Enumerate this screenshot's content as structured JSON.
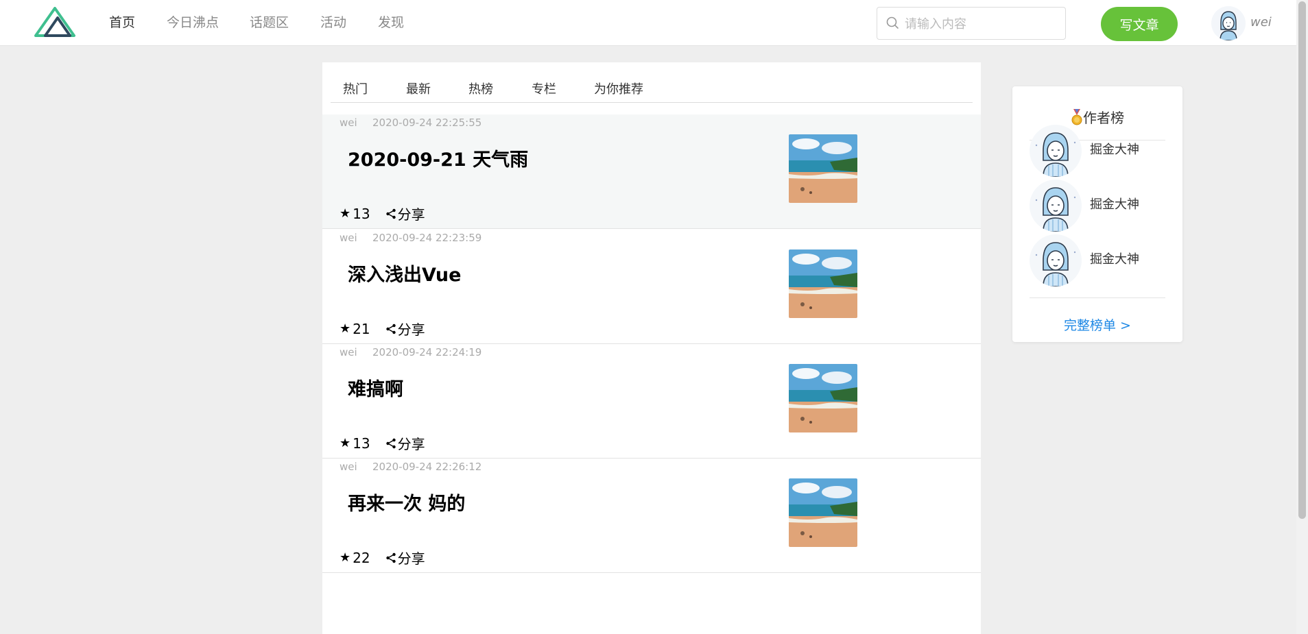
{
  "header": {
    "nav": [
      {
        "label": "首页",
        "active": true
      },
      {
        "label": "今日沸点",
        "active": false
      },
      {
        "label": "话题区",
        "active": false
      },
      {
        "label": "活动",
        "active": false
      },
      {
        "label": "发现",
        "active": false
      }
    ],
    "search": {
      "placeholder": "请输入内容",
      "value": "",
      "icon": "search-icon"
    },
    "write_label": "写文章",
    "user": {
      "name": "wei",
      "avatar": "avatar-icon"
    },
    "colors": {
      "accent": "#67c23a",
      "logo_green": "#3fbf8f",
      "logo_dark": "#2f495e"
    }
  },
  "feed": {
    "tabs": [
      "热门",
      "最新",
      "热榜",
      "专栏",
      "为你推荐"
    ],
    "articles": [
      {
        "author": "wei",
        "time": "2020-09-24 22:25:55",
        "title": "2020-09-21 天气雨",
        "stars": "13",
        "share": "分享"
      },
      {
        "author": "wei",
        "time": "2020-09-24 22:23:59",
        "title": "深入浅出Vue",
        "stars": "21",
        "share": "分享"
      },
      {
        "author": "wei",
        "time": "2020-09-24 22:24:19",
        "title": "难搞啊",
        "stars": "13",
        "share": "分享"
      },
      {
        "author": "wei",
        "time": "2020-09-24 22:26:12",
        "title": "再来一次 妈的",
        "stars": "22",
        "share": "分享"
      }
    ],
    "thumbnail": "beach-photo",
    "star_glyph": "★"
  },
  "sidebar": {
    "title": "作者榜",
    "title_icon": "medal-icon",
    "authors": [
      {
        "name": "掘金大神"
      },
      {
        "name": "掘金大神"
      },
      {
        "name": "掘金大神"
      }
    ],
    "more_label": "完整榜单 >",
    "link_color": "#1e88e5"
  }
}
